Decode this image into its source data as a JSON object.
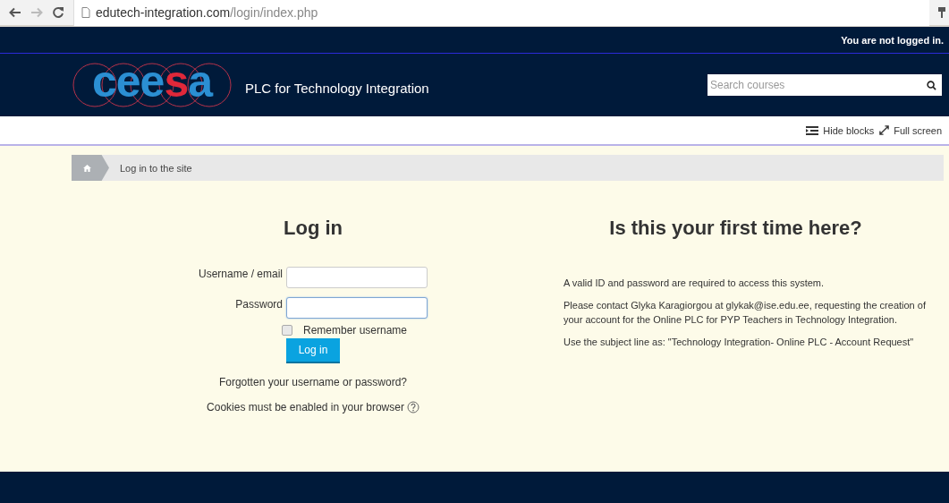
{
  "browser": {
    "url_domain": "edutech-integration.com",
    "url_path": "/login/index.php"
  },
  "navbar": {
    "login_status": "You are not logged in.",
    "logo": [
      {
        "text": "cee",
        "color": "#2b8fd3"
      },
      {
        "text": "s",
        "color": "#e0283a"
      },
      {
        "text": "a",
        "color": "#2b8fd3"
      }
    ],
    "site_name": "PLC for Technology Integration",
    "search": {
      "placeholder": "Search courses"
    }
  },
  "page_actions": [
    {
      "kind": "hide",
      "label": "Hide blocks"
    },
    {
      "kind": "fullscreen",
      "label": "Full screen"
    }
  ],
  "breadcrumb": {
    "current": "Log in to the site"
  },
  "login": {
    "title": "Log in",
    "fields": [
      {
        "label": "Username / email",
        "focused": false
      },
      {
        "label": "Password",
        "focused": true
      }
    ],
    "remember": {
      "label": "Remember username",
      "checked": false
    },
    "button": "Log in",
    "forgot_link": "Forgotten your username or password?",
    "cookies_note": "Cookies must be enabled in your browser"
  },
  "info": {
    "title": "Is this your first time here?",
    "paragraphs": [
      "A valid ID and password are required to access this system.",
      "Please contact Glyka Karagiorgou at glykak@ise.edu.ee, requesting the creation of your account for the Online PLC for PYP Teachers in Technology Integration.",
      "Use the subject line as: \"Technology Integration- Online PLC - Account Request\""
    ]
  }
}
